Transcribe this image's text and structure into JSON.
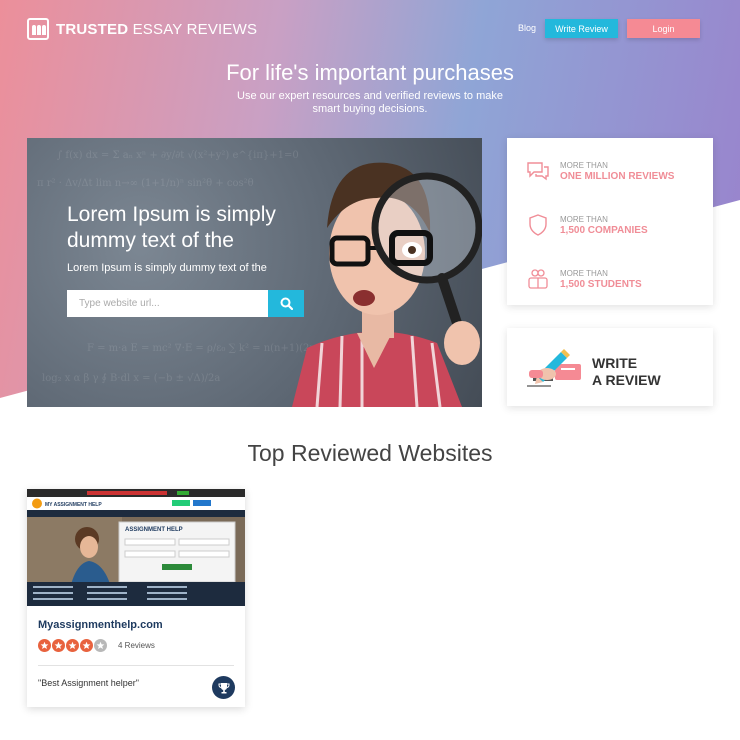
{
  "header": {
    "logo_bold": "TRUSTED",
    "logo_rest": " ESSAY REVIEWS",
    "nav_blog": "Blog",
    "write_review_button": "Write Review",
    "login_button": "Login"
  },
  "hero": {
    "title": "For life's important purchases",
    "subtitle": "Use our expert resources and verified reviews to make smart buying decisions."
  },
  "banner": {
    "heading": "Lorem Ipsum is simply dummy text of the",
    "text": "Lorem Ipsum is simply dummy text of the",
    "search_placeholder": "Type website url..."
  },
  "stats": [
    {
      "small": "MORE THAN",
      "big": "ONE MILLION REVIEWS",
      "icon": "chat-icon"
    },
    {
      "small": "MORE THAN",
      "big": "1,500 COMPANIES",
      "icon": "shield-icon"
    },
    {
      "small": "MORE THAN",
      "big": "1,500 STUDENTS",
      "icon": "students-icon"
    }
  ],
  "write_card": {
    "line1": "WRITE",
    "line2": "A REVIEW"
  },
  "section": {
    "title": "Top Reviewed Websites"
  },
  "site_card": {
    "name": "Myassignmenthelp.com",
    "rating": 4,
    "rating_max": 5,
    "reviews": "4 Reviews",
    "quote": "\"Best Assignment helper\"",
    "thumbnail": {
      "brand": "MY ASSIGNMENT HELP",
      "form_title": "ASSIGNMENT HELP"
    }
  },
  "colors": {
    "accent_blue": "#23b8dc",
    "accent_pink": "#f58a94",
    "navy": "#1e3a5f",
    "star": "#e8623e"
  }
}
